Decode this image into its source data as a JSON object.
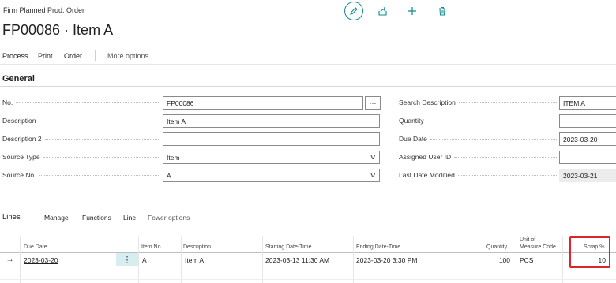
{
  "header": {
    "caption": "Firm Planned Prod. Order",
    "title": "FP00086 · Item A",
    "icons": [
      "edit-icon",
      "share-icon",
      "add-icon",
      "delete-icon"
    ]
  },
  "actions": {
    "process": "Process",
    "print": "Print",
    "order": "Order",
    "more": "More options"
  },
  "general": {
    "title": "General",
    "left_fields": [
      {
        "label": "No.",
        "value": "FP00086"
      },
      {
        "label": "Description",
        "value": "Item A"
      },
      {
        "label": "Description 2",
        "value": ""
      },
      {
        "label": "Source Type",
        "value": "Item"
      },
      {
        "label": "Source No.",
        "value": "A"
      }
    ],
    "right_fields": [
      {
        "label": "Search Description",
        "value": "ITEM A"
      },
      {
        "label": "Quantity",
        "value": ""
      },
      {
        "label": "Due Date",
        "value": "2023-03-20"
      },
      {
        "label": "Assigned User ID",
        "value": ""
      },
      {
        "label": "Last Date Modified",
        "value": "2023-03-21"
      }
    ],
    "ellipsis": "···"
  },
  "lines": {
    "title": "Lines",
    "actions": {
      "manage": "Manage",
      "functions": "Functions",
      "line": "Line",
      "fewer": "Fewer options"
    },
    "columns": {
      "due_date": "Due Date",
      "item_no": "Item No.",
      "description": "Description",
      "starting": "Starting Date-Time",
      "ending": "Ending Date-Time",
      "quantity": "Quantity",
      "uom_1": "Unit of",
      "uom_2": "Measure Code",
      "scrap": "Scrap %"
    },
    "rows": [
      {
        "arrow": "→",
        "menu": "⋮",
        "due_date": "2023-03-20",
        "item_no": "A",
        "description": "Item A",
        "starting": "2023-03-13 11:30 AM",
        "ending": "2023-03-20 3:30 PM",
        "quantity": "100",
        "uom": "PCS",
        "scrap": "10"
      }
    ]
  },
  "colors": {
    "accent": "#0e8a8e",
    "highlight": "#d9262c",
    "selected_cell": "#d7eef0"
  }
}
